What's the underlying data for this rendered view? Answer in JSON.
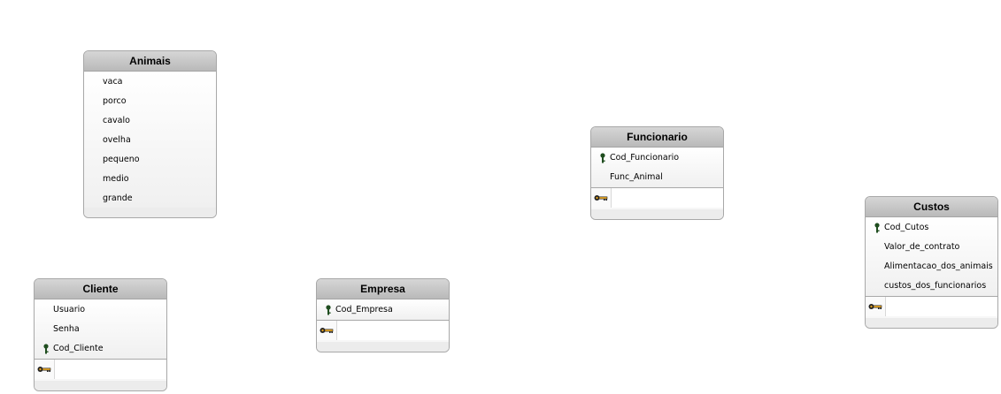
{
  "entities": {
    "animais": {
      "title": "Animais",
      "attributes": [
        {
          "name": "vaca",
          "primary_key": false
        },
        {
          "name": "porco",
          "primary_key": false
        },
        {
          "name": "cavalo",
          "primary_key": false
        },
        {
          "name": "ovelha",
          "primary_key": false
        },
        {
          "name": "pequeno",
          "primary_key": false
        },
        {
          "name": "medio",
          "primary_key": false
        },
        {
          "name": "grande",
          "primary_key": false
        }
      ]
    },
    "cliente": {
      "title": "Cliente",
      "attributes": [
        {
          "name": "Usuario",
          "primary_key": false
        },
        {
          "name": "Senha",
          "primary_key": false
        },
        {
          "name": "Cod_Cliente",
          "primary_key": true
        }
      ]
    },
    "empresa": {
      "title": "Empresa",
      "attributes": [
        {
          "name": "Cod_Empresa",
          "primary_key": true
        }
      ]
    },
    "funcionario": {
      "title": "Funcionario",
      "attributes": [
        {
          "name": "Cod_Funcionario",
          "primary_key": true
        },
        {
          "name": "Func_Animal",
          "primary_key": false
        }
      ]
    },
    "custos": {
      "title": "Custos",
      "attributes": [
        {
          "name": "Cod_Cutos",
          "primary_key": true
        },
        {
          "name": "Valor_de_contrato",
          "primary_key": false
        },
        {
          "name": "Alimentacao_dos_animais",
          "primary_key": false
        },
        {
          "name": "custos_dos_funcionarios",
          "primary_key": false
        }
      ]
    }
  },
  "icons": {
    "primary_key": "primary-key-icon",
    "index_key": "index-key-icon"
  },
  "colors": {
    "primary_key_icon": "#1f4d1f",
    "index_key_icon": "#e0a020",
    "header_bg": "#c4c4c4",
    "border": "#a8a8a8"
  }
}
